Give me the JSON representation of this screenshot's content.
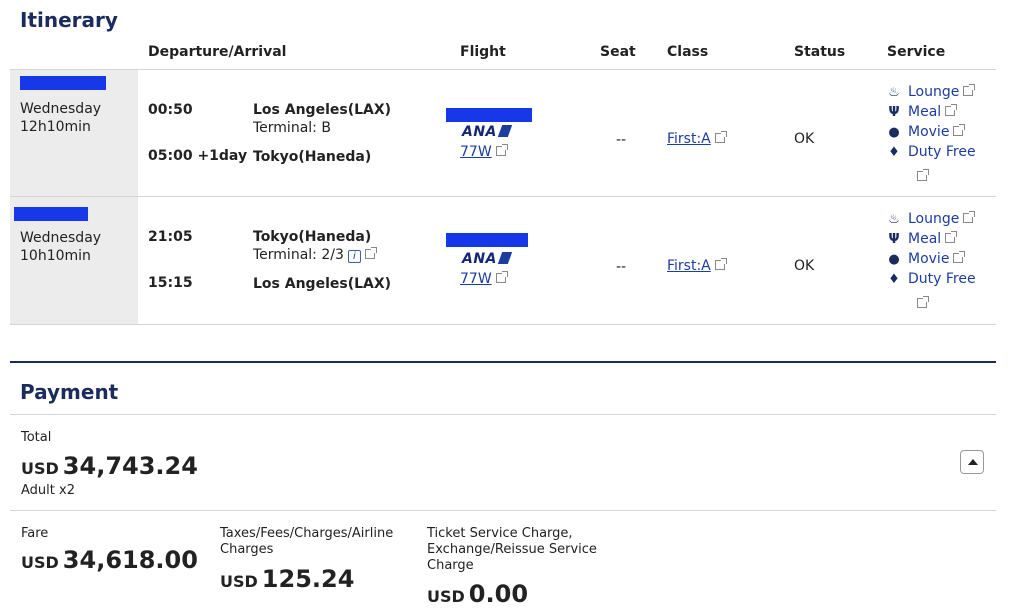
{
  "itinerary": {
    "title": "Itinerary",
    "columns": {
      "departure_arrival": "Departure/Arrival",
      "flight": "Flight",
      "seat": "Seat",
      "class": "Class",
      "status": "Status",
      "service": "Service"
    },
    "segments": [
      {
        "day": "Wednesday",
        "duration": "12h10min",
        "dep_time": "00:50",
        "dep_place": "Los Angeles(LAX)",
        "dep_terminal": "Terminal: B",
        "arr_time": "05:00 +1day",
        "arr_place": "Tokyo(Haneda)",
        "airline": "ANA",
        "aircraft": "77W",
        "seat": "--",
        "class": "First:A",
        "status": "OK",
        "services": [
          "Lounge",
          "Meal",
          "Movie",
          "Duty Free"
        ]
      },
      {
        "day": "Wednesday",
        "duration": "10h10min",
        "dep_time": "21:05",
        "dep_place": "Tokyo(Haneda)",
        "dep_terminal": "Terminal: 2/3",
        "arr_time": "15:15",
        "arr_place": "Los Angeles(LAX)",
        "airline": "ANA",
        "aircraft": "77W",
        "seat": "--",
        "class": "First:A",
        "status": "OK",
        "services": [
          "Lounge",
          "Meal",
          "Movie",
          "Duty Free"
        ]
      }
    ]
  },
  "payment": {
    "title": "Payment",
    "total_label": "Total",
    "total_currency": "USD",
    "total_amount": "34,743.24",
    "passengers": "Adult x2",
    "fare_label": "Fare",
    "fare_currency": "USD",
    "fare_amount": "34,618.00",
    "taxes_label_1": "Taxes/Fees/Charges/Airline",
    "taxes_label_2": "Charges",
    "taxes_currency": "USD",
    "taxes_amount": "125.24",
    "ticket_label_1": "Ticket Service Charge,",
    "ticket_label_2": "Exchange/Reissue Service",
    "ticket_label_3": "Charge",
    "ticket_currency": "USD",
    "ticket_amount": "0.00"
  },
  "icons": {
    "lounge": "lounge-icon",
    "meal": "meal-icon",
    "movie": "movie-icon",
    "duty_free": "duty-free-icon",
    "external": "external-link-icon",
    "info": "info-icon",
    "collapse": "chevron-up-icon"
  }
}
